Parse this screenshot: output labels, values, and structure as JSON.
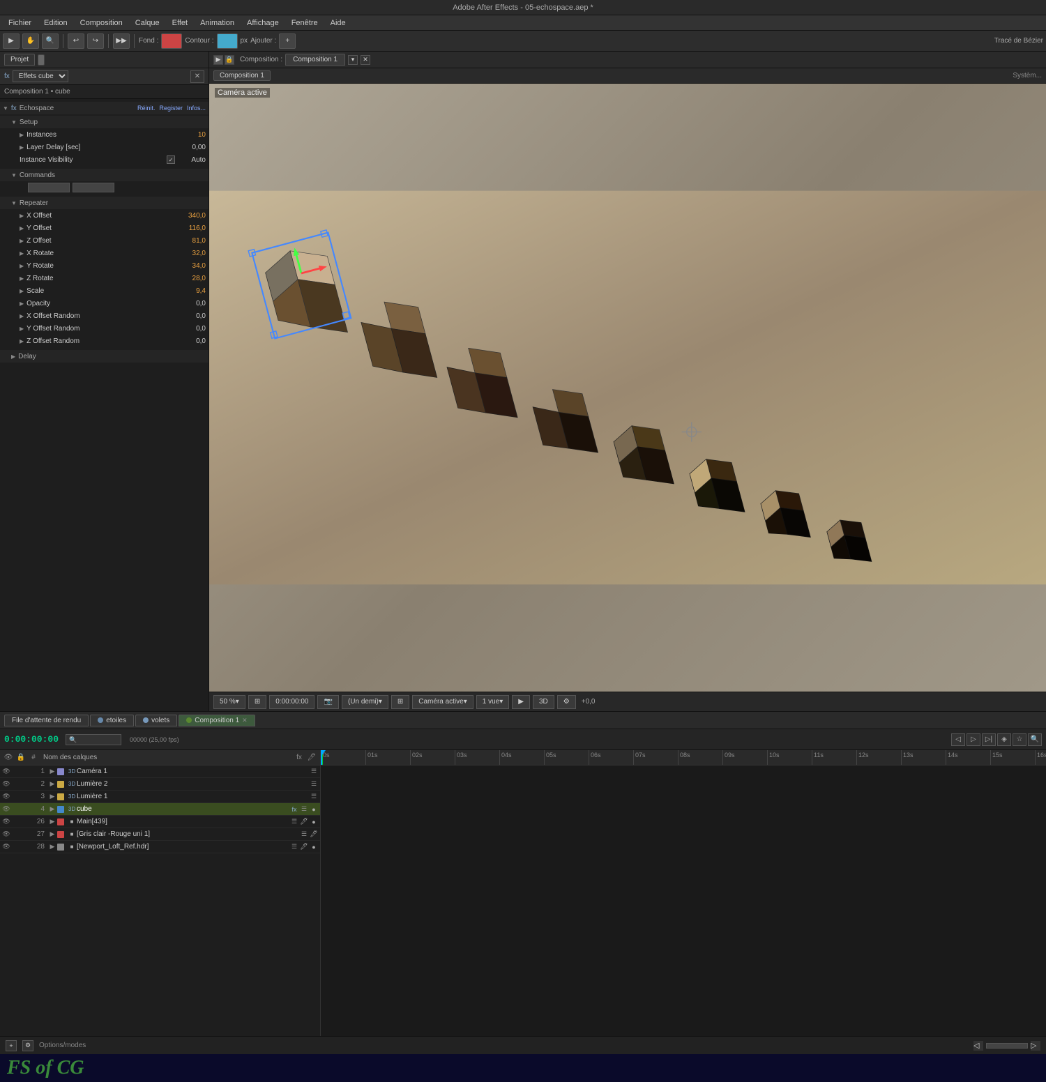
{
  "app": {
    "title": "Adobe After Effects - 05-echospace.aep *",
    "title_bar_text": "Adobe After Effects - 05-echospace.aep *"
  },
  "menu": {
    "items": [
      "Fichier",
      "Edition",
      "Composition",
      "Calque",
      "Effet",
      "Animation",
      "Affichage",
      "Fenêtre",
      "Aide"
    ]
  },
  "panels": {
    "left": {
      "tab_label": "Projet",
      "effects_dropdown": "Effets cube",
      "breadcrumb": "Composition 1 • cube",
      "echospace_label": "Echospace",
      "action_buttons": [
        "Réinit.",
        "Register",
        "Infos..."
      ],
      "sections": {
        "setup": {
          "label": "Setup",
          "instances_label": "Instances",
          "instances_value": "10",
          "layer_delay_label": "Layer Delay [sec]",
          "layer_delay_value": "0,00",
          "instance_visibility_label": "Instance Visibility",
          "instance_visibility_value": "Auto"
        },
        "commands": {
          "label": "Commands",
          "btn1": "",
          "btn2": ""
        },
        "repeater": {
          "label": "Repeater",
          "x_offset_label": "X Offset",
          "x_offset_value": "340,0",
          "y_offset_label": "Y Offset",
          "y_offset_value": "116,0",
          "z_offset_label": "Z Offset",
          "z_offset_value": "81,0",
          "x_rotate_label": "X Rotate",
          "x_rotate_value": "32,0",
          "y_rotate_label": "Y Rotate",
          "y_rotate_value": "34,0",
          "z_rotate_label": "Z Rotate",
          "z_rotate_value": "28,0",
          "scale_label": "Scale",
          "scale_value": "9,4",
          "opacity_label": "Opacity",
          "opacity_value": "0,0",
          "x_offset_random_label": "X Offset Random",
          "x_offset_random_value": "0,0",
          "y_offset_random_label": "Y Offset Random",
          "y_offset_random_value": "0,0",
          "z_offset_random_label": "Z Offset Random",
          "z_offset_random_value": "0,0"
        },
        "delay": {
          "label": "Delay"
        }
      }
    },
    "composition": {
      "tab_label": "Composition 1",
      "header_label": "Composition : Composition 1",
      "comp_tab": "Composition 1",
      "active_camera": "Caméra active",
      "zoom": "50 %",
      "quality": "(Un demi)",
      "camera": "Caméra active",
      "view": "1 vue",
      "time_display": "0:00:00:00",
      "offset_display": "+0,0"
    }
  },
  "bottom_tabs": [
    {
      "label": "File d'attente de rendu",
      "color": "#888888",
      "active": false
    },
    {
      "label": "etoiles",
      "color": "#6666aa",
      "active": false
    },
    {
      "label": "volets",
      "color": "#6688aa",
      "active": false
    },
    {
      "label": "Composition 1",
      "color": "#4d7a2a",
      "active": true
    }
  ],
  "timeline": {
    "time_display": "0:00:00:00",
    "fps_label": "00000 (25,00 fps)",
    "ruler_marks": [
      "0s",
      "01s",
      "02s",
      "03s",
      "04s",
      "05s",
      "06s",
      "07s",
      "08s",
      "09s",
      "10s",
      "11s",
      "12s",
      "13s",
      "14s",
      "15s",
      "16s"
    ],
    "layers": [
      {
        "num": 1,
        "name": "Caméra 1",
        "color": "#8888cc",
        "type": "camera",
        "track_color": "#888888"
      },
      {
        "num": 2,
        "name": "Lumière 2",
        "color": "#ccaa44",
        "type": "light",
        "track_color": "#c8b870"
      },
      {
        "num": 3,
        "name": "Lumière 1",
        "color": "#ccaa44",
        "type": "light",
        "track_color": "#8888aa"
      },
      {
        "num": 4,
        "name": "cube",
        "color": "#4488cc",
        "type": "solid",
        "track_color": "#5588cc",
        "active": true
      },
      {
        "num": 26,
        "name": "Main[439]",
        "color": "#cc4444",
        "type": "solid",
        "track_color": "#cc6644"
      },
      {
        "num": 27,
        "name": "[Gris clair -Rouge uni 1]",
        "color": "#cc4444",
        "type": "solid",
        "track_color": "#aa4444"
      },
      {
        "num": 28,
        "name": "[Newport_Loft_Ref.hdr]",
        "color": "#aaaaaa",
        "type": "solid",
        "track_color": "#8888aa"
      }
    ],
    "layer_header_label": "Nom des calques"
  },
  "status_bar": {
    "options_label": "Options/modes"
  },
  "watermark": {
    "text": "FS of CG"
  }
}
